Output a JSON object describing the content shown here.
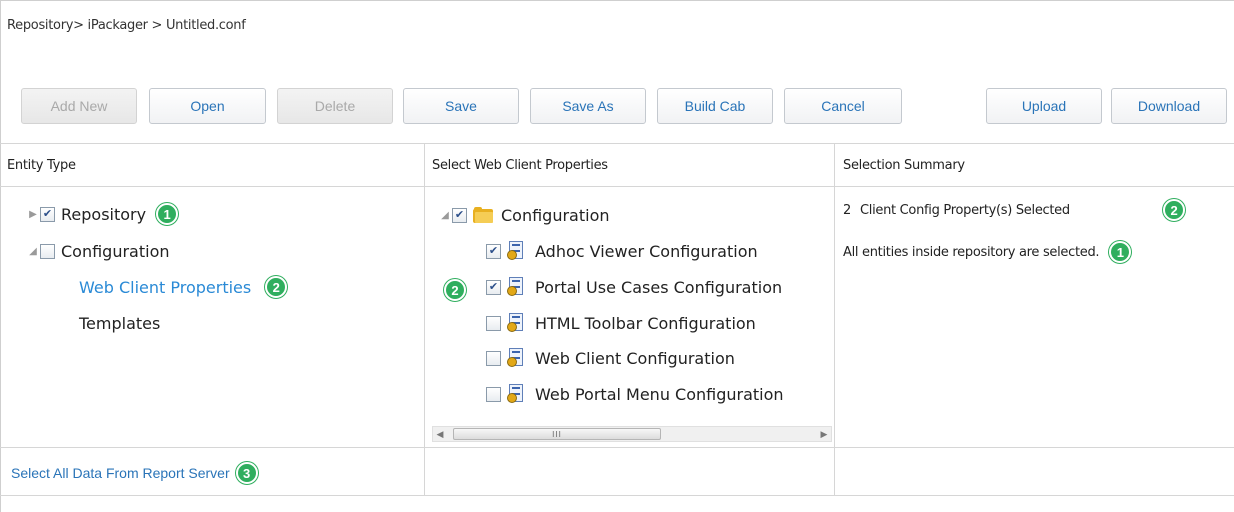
{
  "breadcrumb": "Repository> iPackager > Untitled.conf",
  "toolbar": {
    "add_new": "Add New",
    "open": "Open",
    "delete": "Delete",
    "save": "Save",
    "save_as": "Save As",
    "build_cab": "Build Cab",
    "cancel": "Cancel",
    "upload": "Upload",
    "download": "Download"
  },
  "columns": {
    "entity_type": "Entity Type",
    "web_client_properties": "Select Web Client Properties",
    "selection_summary": "Selection Summary"
  },
  "entity_tree": {
    "repository": {
      "label": "Repository",
      "checked": true,
      "badge": "1"
    },
    "configuration": {
      "label": "Configuration",
      "checked": false
    },
    "web_client_properties": {
      "label": "Web Client Properties",
      "badge": "2"
    },
    "templates": {
      "label": "Templates"
    }
  },
  "properties_tree": {
    "root": {
      "label": "Configuration"
    },
    "badge": "2",
    "items": [
      {
        "label": "Adhoc Viewer Configuration",
        "checked": true
      },
      {
        "label": "Portal Use Cases Configuration",
        "checked": true
      },
      {
        "label": "HTML Toolbar Configuration",
        "checked": false
      },
      {
        "label": "Web Client Configuration",
        "checked": false
      },
      {
        "label": "Web Portal Menu Configuration",
        "checked": false
      }
    ]
  },
  "summary": {
    "line1_count": "2",
    "line1_text": "Client Config Property(s) Selected",
    "line1_badge": "2",
    "line2_text": "All entities inside repository are selected.",
    "line2_badge": "1"
  },
  "footer": {
    "select_all_label": "Select All Data From Report Server",
    "badge": "3"
  },
  "scrollbar": {
    "thumb_grip": "III"
  },
  "colors": {
    "accent": "#2a74b8",
    "link": "#2a8ad6",
    "badge": "#2fae5e"
  }
}
